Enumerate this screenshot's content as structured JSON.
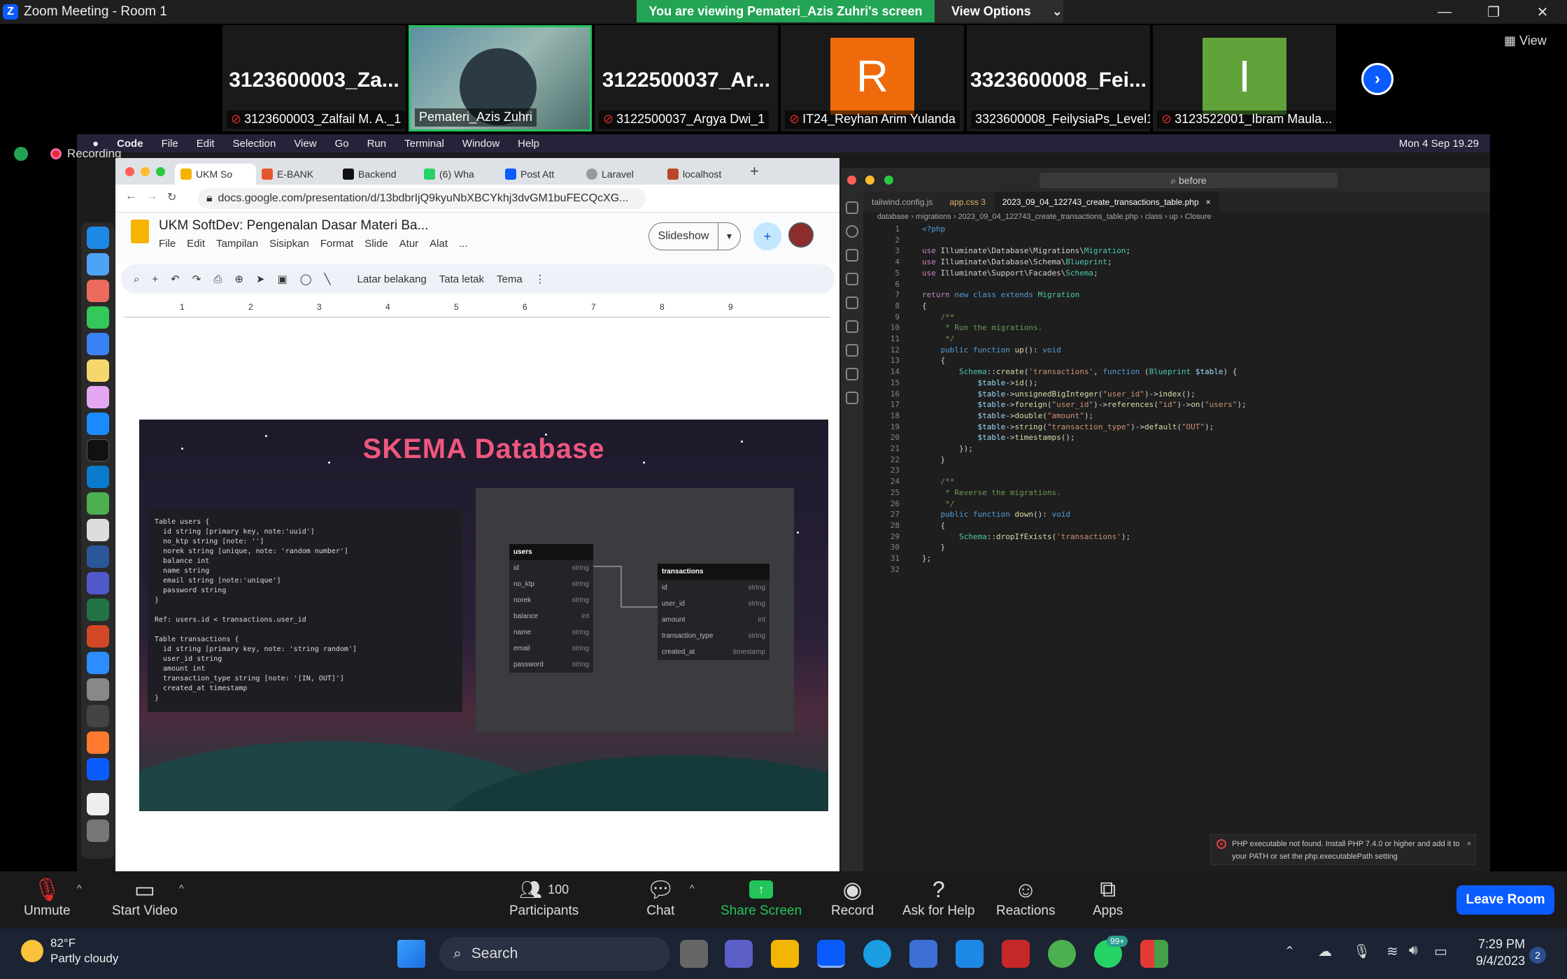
{
  "window": {
    "title": "Zoom Meeting - Room 1"
  },
  "banner": {
    "viewing": "You are viewing Pemateri_Azis Zuhri's screen",
    "view_options": "View Options",
    "view_label": "View"
  },
  "participants": [
    {
      "big": "3123600003_Za...",
      "label": "3123600003_Zalfail M. A._1",
      "muted": true,
      "avatar": ""
    },
    {
      "big": "",
      "label": "Pemateri_Azis Zuhri",
      "muted": false,
      "avatar": ""
    },
    {
      "big": "3122500037_Ar...",
      "label": "3122500037_Argya Dwi_1",
      "muted": true,
      "avatar": ""
    },
    {
      "big": "",
      "label": "IT24_Reyhan Arim Yulanda",
      "muted": true,
      "avatar": "R",
      "color": "#ee6a0a"
    },
    {
      "big": "3323600008_Fei...",
      "label": "3323600008_FeilysiaPs_Level1",
      "muted": false,
      "avatar": ""
    },
    {
      "big": "",
      "label": "3123522001_Ibram Maula...",
      "muted": true,
      "avatar": "I",
      "color": "#61a33a"
    }
  ],
  "recording": "Recording",
  "macmenu": {
    "apple": "",
    "items": [
      "Code",
      "File",
      "Edit",
      "Selection",
      "View",
      "Go",
      "Run",
      "Terminal",
      "Window",
      "Help"
    ],
    "clock": "Mon 4 Sep  19.29"
  },
  "browser": {
    "tabs": [
      "UKM So",
      "E-BANK",
      "Backend",
      "(6) Wha",
      "Post Att",
      "Laravel",
      "localhost"
    ],
    "url": "docs.google.com/presentation/d/13bdbrIjQ9kyuNbXBCYkhj3dvGM1buFECQcXG...",
    "doc_title": "UKM SoftDev: Pengenalan Dasar Materi Ba...",
    "menus": [
      "File",
      "Edit",
      "Tampilan",
      "Sisipkan",
      "Format",
      "Slide",
      "Atur",
      "Alat",
      "..."
    ],
    "slideshow": "Slideshow",
    "toolbar": {
      "background": "Latar belakang",
      "layout": "Tata letak",
      "theme": "Tema"
    },
    "ruler": [
      "1",
      "2",
      "3",
      "4",
      "5",
      "6",
      "7",
      "8",
      "9"
    ]
  },
  "slide": {
    "title": "SKEMA Database",
    "dbml": "Table users {\n  id string [primary key, note:'uuid']\n  no_ktp string [note: '']\n  norek string [unique, note: 'random number']\n  balance int\n  name string\n  email string [note:'unique']\n  password string\n}\n\nRef: users.id < transactions.user_id\n\nTable transactions {\n  id string [primary key, note: 'string random']\n  user_id string\n  amount int\n  transaction_type string [note: '[IN, OUT]']\n  created_at timestamp\n}",
    "users_table": {
      "name": "users",
      "rows": [
        [
          "id",
          "string"
        ],
        [
          "no_ktp",
          "string"
        ],
        [
          "norek",
          "string"
        ],
        [
          "balance",
          "int"
        ],
        [
          "name",
          "string"
        ],
        [
          "email",
          "string"
        ],
        [
          "password",
          "string"
        ]
      ]
    },
    "transactions_table": {
      "name": "transactions",
      "rows": [
        [
          "id",
          "string"
        ],
        [
          "user_id",
          "string"
        ],
        [
          "amount",
          "int"
        ],
        [
          "transaction_type",
          "string"
        ],
        [
          "created_at",
          "timestamp"
        ]
      ]
    }
  },
  "vscode": {
    "search": "before",
    "tabs": [
      "tailwind.config.js",
      "app.css 3",
      "2023_09_04_122743_create_transactions_table.php"
    ],
    "breadcrumb": "database › migrations › 2023_09_04_122743_create_transactions_table.php › class › up › Closure",
    "error": "PHP executable not found. Install PHP 7.4.0 or higher and add it to your PATH or set the php.executablePath setting"
  },
  "zoombar": {
    "unmute": "Unmute",
    "start_video": "Start Video",
    "participants": "Participants",
    "participants_count": "100",
    "chat": "Chat",
    "share": "Share Screen",
    "record": "Record",
    "help": "Ask for Help",
    "reactions": "Reactions",
    "apps": "Apps",
    "leave": "Leave Room"
  },
  "taskbar": {
    "temp": "82°F",
    "weather": "Partly cloudy",
    "search": "Search",
    "time": "7:29 PM",
    "date": "9/4/2023",
    "notifications": "2",
    "badge": "99+"
  }
}
